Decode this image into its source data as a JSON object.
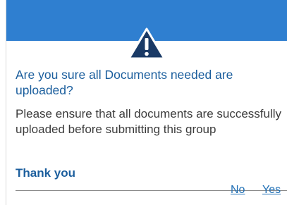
{
  "dialog": {
    "header_color": "#2f7fd0",
    "icon": "warning-triangle-icon",
    "title": "Are you sure all Documents needed are uploaded?",
    "message": "Please ensure that all documents are successfully uploaded before submitting this group",
    "thanks": "Thank you",
    "buttons": {
      "no_label": "No",
      "yes_label": "Yes"
    }
  }
}
